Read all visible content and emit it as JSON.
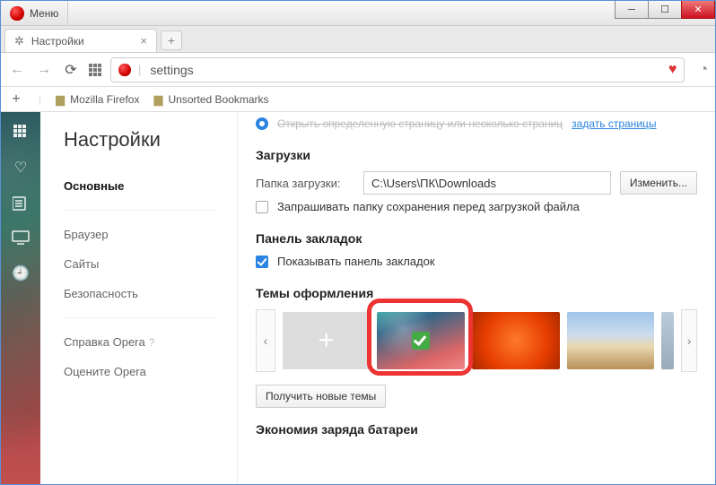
{
  "window": {
    "menu_label": "Меню"
  },
  "tabs": {
    "settings_label": "Настройки"
  },
  "address": {
    "value": "settings"
  },
  "bookmark_bar": {
    "items": [
      "Mozilla Firefox",
      "Unsorted Bookmarks"
    ]
  },
  "rail": {
    "icons": [
      "speed-dial",
      "heart",
      "news",
      "monitor",
      "history"
    ]
  },
  "settings_nav": {
    "title": "Настройки",
    "items": [
      {
        "label": "Основные",
        "active": true
      },
      {
        "label": "Браузер"
      },
      {
        "label": "Сайты"
      },
      {
        "label": "Безопасность"
      }
    ],
    "help_label": "Справка Opera",
    "rate_label": "Оцените Opera"
  },
  "content": {
    "startup": {
      "link_text": "задать страницы"
    },
    "downloads": {
      "title": "Загрузки",
      "folder_label": "Папка загрузки:",
      "folder_value": "C:\\Users\\ПК\\Downloads",
      "change_btn": "Изменить...",
      "ask_label": "Запрашивать папку сохранения перед загрузкой файла"
    },
    "bookmarks_panel": {
      "title": "Панель закладок",
      "show_label": "Показывать панель закладок"
    },
    "themes": {
      "title": "Темы оформления",
      "get_more_btn": "Получить новые темы"
    },
    "battery": {
      "title": "Экономия заряда батареи"
    }
  }
}
